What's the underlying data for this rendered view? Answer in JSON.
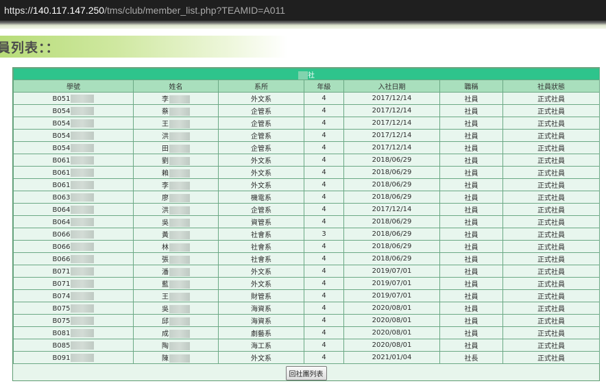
{
  "browser": {
    "url_prefix": "https://",
    "url_host": "140.117.147.250",
    "url_path": "/tms/club/member_list.php?TEAMID=A011"
  },
  "page": {
    "title": "員列表：："
  },
  "table": {
    "club_name": "社",
    "headers": [
      "學號",
      "姓名",
      "系所",
      "年級",
      "入社日期",
      "職稱",
      "社員狀態"
    ],
    "rows": [
      {
        "id": "B051",
        "name": "李",
        "dept": "外文系",
        "grade": "4",
        "date": "2017/12/14",
        "title": "社員",
        "status": "正式社員"
      },
      {
        "id": "B054",
        "name": "蔡",
        "dept": "企管系",
        "grade": "4",
        "date": "2017/12/14",
        "title": "社員",
        "status": "正式社員"
      },
      {
        "id": "B054",
        "name": "王",
        "dept": "企管系",
        "grade": "4",
        "date": "2017/12/14",
        "title": "社員",
        "status": "正式社員"
      },
      {
        "id": "B054",
        "name": "洪",
        "dept": "企管系",
        "grade": "4",
        "date": "2017/12/14",
        "title": "社員",
        "status": "正式社員"
      },
      {
        "id": "B054",
        "name": "田",
        "dept": "企管系",
        "grade": "4",
        "date": "2017/12/14",
        "title": "社員",
        "status": "正式社員"
      },
      {
        "id": "B061",
        "name": "劉",
        "dept": "外文系",
        "grade": "4",
        "date": "2018/06/29",
        "title": "社員",
        "status": "正式社員"
      },
      {
        "id": "B061",
        "name": "賴",
        "dept": "外文系",
        "grade": "4",
        "date": "2018/06/29",
        "title": "社員",
        "status": "正式社員"
      },
      {
        "id": "B061",
        "name": "李",
        "dept": "外文系",
        "grade": "4",
        "date": "2018/06/29",
        "title": "社員",
        "status": "正式社員"
      },
      {
        "id": "B063",
        "name": "廖",
        "dept": "機電系",
        "grade": "4",
        "date": "2018/06/29",
        "title": "社員",
        "status": "正式社員"
      },
      {
        "id": "B064",
        "name": "洪",
        "dept": "企管系",
        "grade": "4",
        "date": "2017/12/14",
        "title": "社員",
        "status": "正式社員"
      },
      {
        "id": "B064",
        "name": "吳",
        "dept": "資管系",
        "grade": "4",
        "date": "2018/06/29",
        "title": "社員",
        "status": "正式社員"
      },
      {
        "id": "B066",
        "name": "黃",
        "dept": "社會系",
        "grade": "3",
        "date": "2018/06/29",
        "title": "社員",
        "status": "正式社員"
      },
      {
        "id": "B066",
        "name": "林",
        "dept": "社會系",
        "grade": "4",
        "date": "2018/06/29",
        "title": "社員",
        "status": "正式社員"
      },
      {
        "id": "B066",
        "name": "張",
        "dept": "社會系",
        "grade": "4",
        "date": "2018/06/29",
        "title": "社員",
        "status": "正式社員"
      },
      {
        "id": "B071",
        "name": "潘",
        "dept": "外文系",
        "grade": "4",
        "date": "2019/07/01",
        "title": "社員",
        "status": "正式社員"
      },
      {
        "id": "B071",
        "name": "藍",
        "dept": "外文系",
        "grade": "4",
        "date": "2019/07/01",
        "title": "社員",
        "status": "正式社員"
      },
      {
        "id": "B074",
        "name": "王",
        "dept": "財管系",
        "grade": "4",
        "date": "2019/07/01",
        "title": "社員",
        "status": "正式社員"
      },
      {
        "id": "B075",
        "name": "吳",
        "dept": "海資系",
        "grade": "4",
        "date": "2020/08/01",
        "title": "社員",
        "status": "正式社員"
      },
      {
        "id": "B075",
        "name": "邱",
        "dept": "海資系",
        "grade": "4",
        "date": "2020/08/01",
        "title": "社員",
        "status": "正式社員"
      },
      {
        "id": "B081",
        "name": "成",
        "dept": "劇藝系",
        "grade": "4",
        "date": "2020/08/01",
        "title": "社員",
        "status": "正式社員"
      },
      {
        "id": "B085",
        "name": "陶",
        "dept": "海工系",
        "grade": "4",
        "date": "2020/08/01",
        "title": "社員",
        "status": "正式社員"
      },
      {
        "id": "B091",
        "name": "陳",
        "dept": "外文系",
        "grade": "4",
        "date": "2021/01/04",
        "title": "社長",
        "status": "正式社員"
      }
    ],
    "back_button": "回社團列表"
  }
}
